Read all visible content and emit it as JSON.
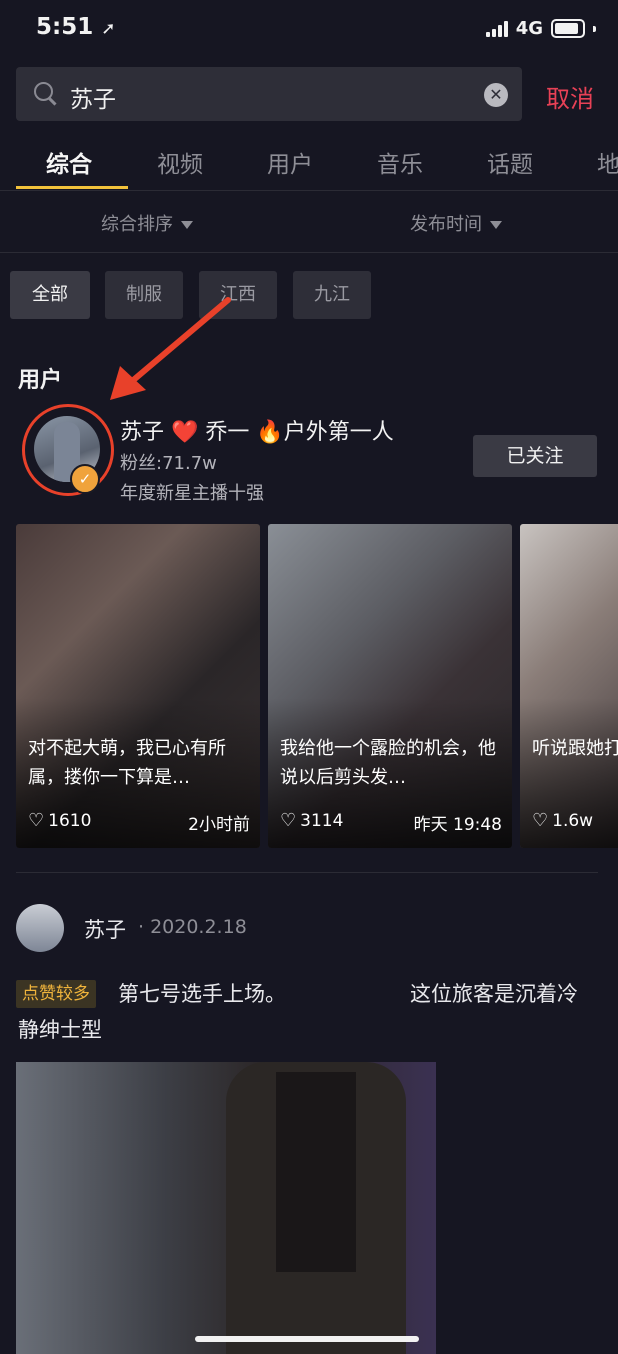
{
  "status": {
    "time": "5:51",
    "network": "4G"
  },
  "search": {
    "query": "苏子",
    "cancel_label": "取消"
  },
  "tabs": [
    "综合",
    "视频",
    "用户",
    "音乐",
    "话题",
    "地"
  ],
  "sort": {
    "left": "综合排序",
    "right": "发布时间"
  },
  "chips": [
    "全部",
    "制服",
    "江西",
    "九江"
  ],
  "user_section": {
    "label": "用户",
    "name": "苏子 ❤️ 乔一 🔥户外第一人",
    "fans": "粉丝:71.7w",
    "desc": "年度新星主播十强",
    "follow_label": "已关注"
  },
  "videos": [
    {
      "title": "对不起大萌，我已心有所属，搂你一下算是…",
      "likes": "1610",
      "time": "2小时前"
    },
    {
      "title": "我给他一个露脸的机会，他说以后剪头发…",
      "likes": "3114",
      "time": "昨天 19:48"
    },
    {
      "title": "听说跟她打火，她的…",
      "likes": "1.6w",
      "time": ""
    }
  ],
  "post": {
    "author": "苏子",
    "date": "· 2020.2.18",
    "badge": "点赞较多",
    "text_a": "第七号选手上场。",
    "text_b": "这位旅客是沉着冷",
    "text_c": "静绅士型"
  },
  "colors": {
    "accent": "#f2c23b",
    "cancel": "#e84156",
    "badge": "#f0b43c",
    "highlight_ring": "#e8412a"
  }
}
